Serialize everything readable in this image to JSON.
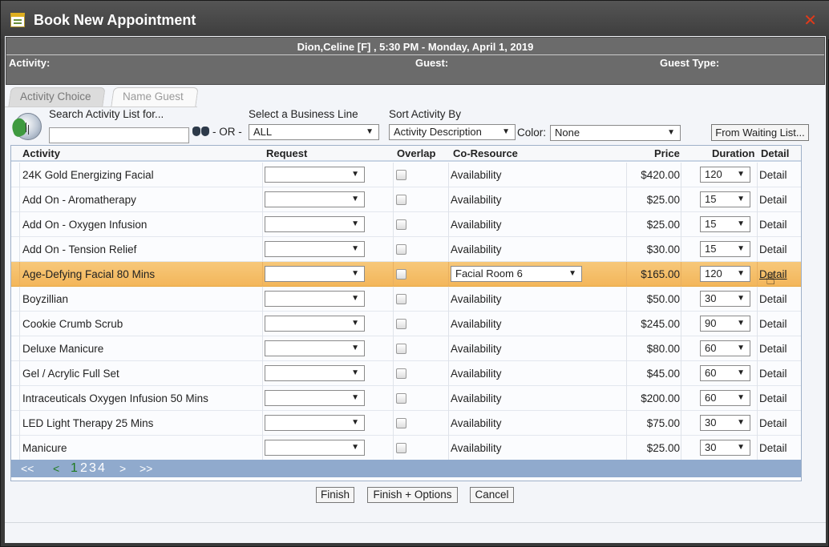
{
  "window": {
    "title": "Book New Appointment"
  },
  "header": {
    "client_line": "Dion,Celine [F] , 5:30 PM - Monday, April 1, 2019",
    "activity_label": "Activity:",
    "guest_label": "Guest:",
    "guest_type_label": "Guest Type:"
  },
  "tabs": [
    {
      "label": "Activity Choice"
    },
    {
      "label": "Name Guest"
    }
  ],
  "filters": {
    "search_label": "Search Activity List for...",
    "search_value": "",
    "or_text": "- OR -",
    "business_line_label": "Select a Business Line",
    "business_line_value": "ALL",
    "sort_label": "Sort Activity By",
    "sort_value": "Activity Description",
    "color_label": "Color:",
    "color_value": "None",
    "waiting_list_button": "From Waiting List..."
  },
  "grid": {
    "headers": {
      "activity": "Activity",
      "request": "Request",
      "overlap": "Overlap",
      "co_resource": "Co-Resource",
      "price": "Price",
      "duration": "Duration",
      "detail": "Detail"
    },
    "rows": [
      {
        "activity": "24K Gold Energizing Facial",
        "co_resource": "Availability",
        "price": "$420.00",
        "duration": "120",
        "detail": "Detail"
      },
      {
        "activity": "Add On - Aromatherapy",
        "co_resource": "Availability",
        "price": "$25.00",
        "duration": "15",
        "detail": "Detail"
      },
      {
        "activity": "Add On - Oxygen Infusion",
        "co_resource": "Availability",
        "price": "$25.00",
        "duration": "15",
        "detail": "Detail"
      },
      {
        "activity": "Add On - Tension Relief",
        "co_resource": "Availability",
        "price": "$30.00",
        "duration": "15",
        "detail": "Detail"
      },
      {
        "activity": "Age-Defying Facial 80 Mins",
        "co_resource": "Facial Room 6",
        "price": "$165.00",
        "duration": "120",
        "detail": "Detail",
        "selected": true
      },
      {
        "activity": "Boyzillian",
        "co_resource": "Availability",
        "price": "$50.00",
        "duration": "30",
        "detail": "Detail"
      },
      {
        "activity": "Cookie Crumb Scrub",
        "co_resource": "Availability",
        "price": "$245.00",
        "duration": "90",
        "detail": "Detail"
      },
      {
        "activity": "Deluxe Manicure",
        "co_resource": "Availability",
        "price": "$80.00",
        "duration": "60",
        "detail": "Detail"
      },
      {
        "activity": "Gel / Acrylic Full Set",
        "co_resource": "Availability",
        "price": "$45.00",
        "duration": "60",
        "detail": "Detail"
      },
      {
        "activity": "Intraceuticals Oxygen Infusion 50 Mins",
        "co_resource": "Availability",
        "price": "$200.00",
        "duration": "60",
        "detail": "Detail"
      },
      {
        "activity": "LED Light Therapy 25 Mins",
        "co_resource": "Availability",
        "price": "$75.00",
        "duration": "30",
        "detail": "Detail"
      },
      {
        "activity": "Manicure",
        "co_resource": "Availability",
        "price": "$25.00",
        "duration": "30",
        "detail": "Detail"
      }
    ]
  },
  "pager": {
    "first": "<<",
    "prev": "<",
    "pages": [
      "1",
      "2",
      "3",
      "4"
    ],
    "next": ">",
    "last": ">>"
  },
  "footer": {
    "finish": "Finish",
    "finish_options": "Finish + Options",
    "cancel": "Cancel"
  },
  "colors": {
    "highlight": "#f5bf6a",
    "pager": "#90aacd",
    "header": "#6b6b6b",
    "close": "#e23a1a"
  }
}
